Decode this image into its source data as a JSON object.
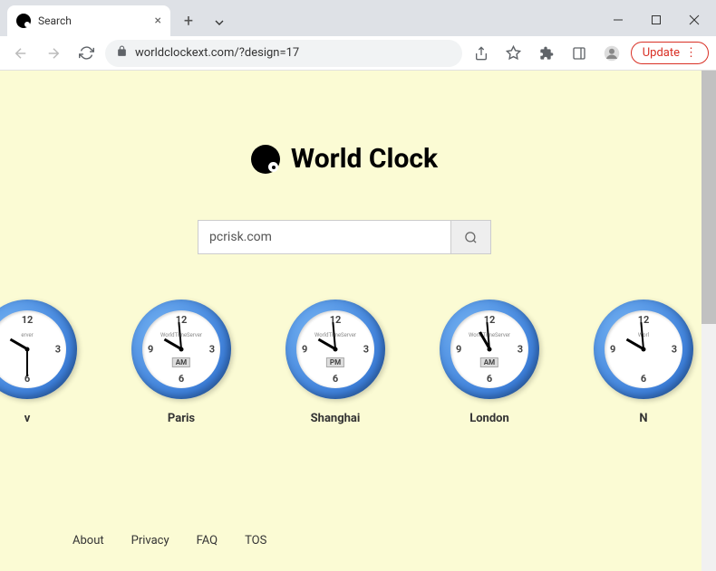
{
  "browser": {
    "tab_title": "Search",
    "url": "worldclockext.com/?design=17",
    "update_label": "Update"
  },
  "page": {
    "title": "World Clock",
    "search_value": "pcrisk.com"
  },
  "clocks": [
    {
      "city": "v",
      "brand": "erver",
      "ampm": "",
      "hour_deg": 300,
      "min_deg": 180,
      "partial": "left"
    },
    {
      "city": "Paris",
      "brand": "WorldTimeServer",
      "ampm": "AM",
      "hour_deg": 300,
      "min_deg": 355
    },
    {
      "city": "Shanghai",
      "brand": "WorldTimeServer",
      "ampm": "PM",
      "hour_deg": 300,
      "min_deg": 355
    },
    {
      "city": "London",
      "brand": "WorldTimeServer",
      "ampm": "AM",
      "hour_deg": 330,
      "min_deg": 355
    },
    {
      "city": "N",
      "brand": "Worl",
      "ampm": "",
      "hour_deg": 300,
      "min_deg": 355,
      "partial": "right"
    }
  ],
  "footer": {
    "about": "About",
    "privacy": "Privacy",
    "faq": "FAQ",
    "tos": "TOS"
  }
}
